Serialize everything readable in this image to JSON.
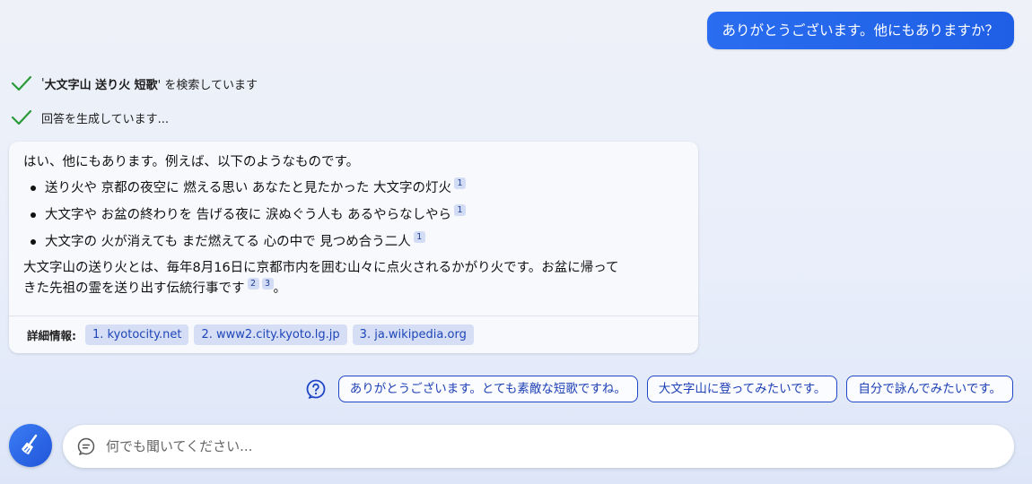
{
  "user_message": "ありがとうございます。他にもありますか？",
  "status": [
    {
      "prefix": "'",
      "query": "大文字山 送り火 短歌",
      "suffix": "' を検索しています"
    },
    {
      "prefix": "",
      "query": "",
      "suffix": "回答を生成しています..."
    }
  ],
  "answer": {
    "intro": "はい、他にもあります。例えば、以下のようなものです。",
    "items": [
      {
        "text": "送り火や 京都の夜空に 燃える思い あなたと見たかった 大文字の灯火",
        "cite": "1"
      },
      {
        "text": "大文字や お盆の終わりを 告げる夜に 涙ぬぐう人も あるやらなしやら",
        "cite": "1"
      },
      {
        "text": "大文字の 火が消えても まだ燃えてる 心の中で 見つめ合う二人",
        "cite": "1"
      }
    ],
    "para_line1": "大文字山の送り火とは、毎年8月16日に京都市内を囲む山々に点火されるかがり火です。お盆に帰って",
    "para_line2": "きた先祖の霊を送り出す伝統行事です",
    "para_cites": [
      "2",
      "3"
    ],
    "para_end": "。"
  },
  "footer": {
    "label": "詳細情報:",
    "sources": [
      "1. kyotocity.net",
      "2. www2.city.kyoto.lg.jp",
      "3. ja.wikipedia.org"
    ]
  },
  "suggestions": [
    "ありがとうございます。とても素敵な短歌ですね。",
    "大文字山に登ってみたいです。",
    "自分で詠んでみたいです。"
  ],
  "input": {
    "placeholder": "何でも聞いてください..."
  },
  "icons": {
    "check": "check-icon",
    "help": "question-circle-icon",
    "broom": "broom-icon",
    "chat": "chat-bubble-icon"
  },
  "colors": {
    "accent": "#1f5fe5",
    "check": "#2a9a3a",
    "chip_bg": "#d6def5",
    "chip_text": "#1e46b8"
  }
}
